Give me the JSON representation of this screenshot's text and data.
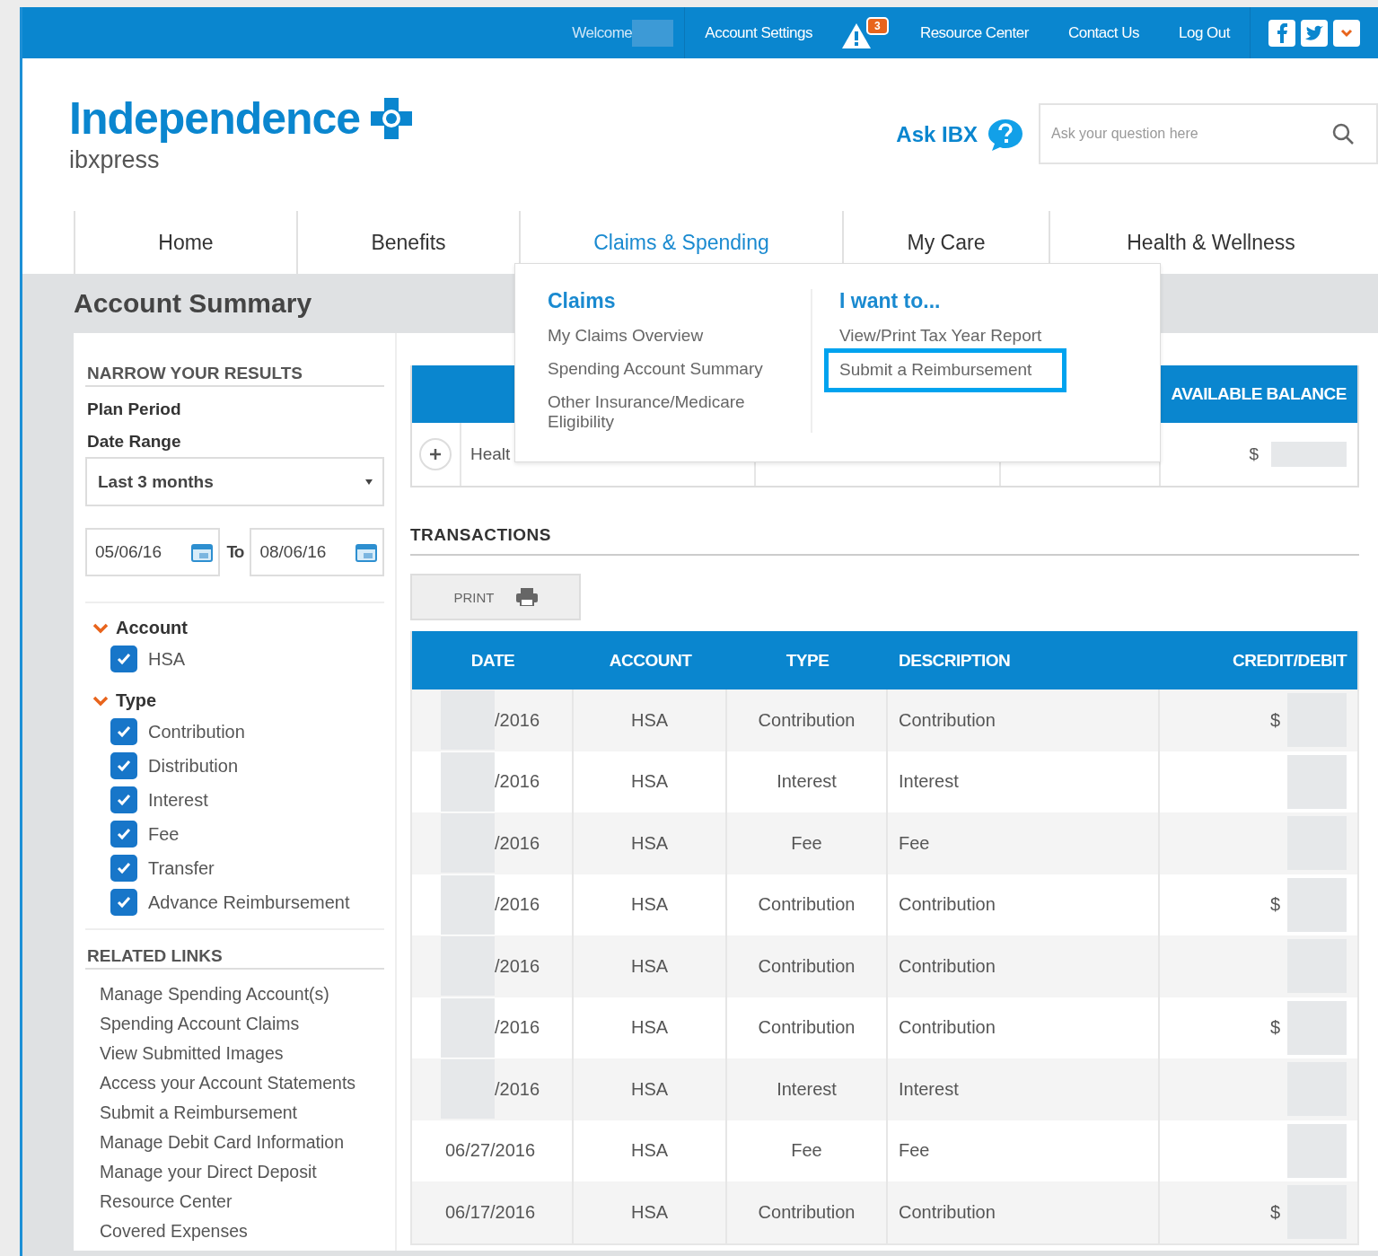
{
  "top_bar": {
    "welcome": "Welcome",
    "links": [
      "Account Settings",
      "Resource Center",
      "Contact Us",
      "Log Out"
    ],
    "alert_count": "3"
  },
  "logo": {
    "name": "Independence",
    "sub": "ibxpress"
  },
  "ask": {
    "label": "Ask IBX",
    "placeholder": "Ask your question here"
  },
  "nav": [
    {
      "label": "Home",
      "selected": false
    },
    {
      "label": "Benefits",
      "selected": false
    },
    {
      "label": "Claims & Spending",
      "selected": true
    },
    {
      "label": "My Care",
      "selected": false
    },
    {
      "label": "Health & Wellness",
      "selected": false
    }
  ],
  "dropdown": {
    "sections": [
      {
        "title": "Claims",
        "links": [
          {
            "label": "My Claims Overview",
            "highlighted": false
          },
          {
            "label": "Spending Account Summary",
            "highlighted": false
          },
          {
            "label": "Other Insurance/Medicare Eligibility",
            "highlighted": false
          }
        ]
      },
      {
        "title": "I want to...",
        "links": [
          {
            "label": "View/Print Tax Year Report",
            "highlighted": false
          },
          {
            "label": "Submit a Reimbursement",
            "highlighted": true
          }
        ]
      }
    ]
  },
  "page_title": "Account Summary",
  "filters": {
    "heading": "NARROW YOUR RESULTS",
    "plan_period": "Plan Period",
    "date_range_label": "Date Range",
    "date_range": "Last 3 months",
    "from": "05/06/16",
    "to_label": "To",
    "to": "08/06/16",
    "groups": [
      {
        "title": "Account",
        "expanded": true,
        "options": [
          {
            "label": "HSA",
            "checked": true
          }
        ]
      },
      {
        "title": "Type",
        "expanded": true,
        "options": [
          {
            "label": "Contribution",
            "checked": true
          },
          {
            "label": "Distribution",
            "checked": true
          },
          {
            "label": "Interest",
            "checked": true
          },
          {
            "label": "Fee",
            "checked": true
          },
          {
            "label": "Transfer",
            "checked": true
          },
          {
            "label": "Advance Reimbursement",
            "checked": true
          }
        ]
      }
    ]
  },
  "related_links": {
    "heading": "RELATED LINKS",
    "links": [
      "Manage Spending Account(s)",
      "Spending Account Claims",
      "View Submitted Images",
      "Access your Account Statements",
      "Submit a Reimbursement",
      "Manage Debit Card Information",
      "Manage your Direct Deposit",
      "Resource Center",
      "Covered Expenses"
    ]
  },
  "account_table": {
    "balance_header": "AVAILABLE BALANCE",
    "rows": [
      {
        "name": "Healt",
        "balance": "$"
      }
    ]
  },
  "transactions": {
    "title": "TRANSACTIONS",
    "print_label": "PRINT",
    "columns": [
      "DATE",
      "ACCOUNT",
      "TYPE",
      "DESCRIPTION",
      "CREDIT/DEBIT"
    ],
    "rows": [
      {
        "date": "/2016",
        "date_redacted": true,
        "account": "HSA",
        "type": "Contribution",
        "description": "Contribution",
        "credit": "$"
      },
      {
        "date": "/2016",
        "date_redacted": true,
        "account": "HSA",
        "type": "Interest",
        "description": "Interest",
        "credit": ""
      },
      {
        "date": "/2016",
        "date_redacted": true,
        "account": "HSA",
        "type": "Fee",
        "description": "Fee",
        "credit": ""
      },
      {
        "date": "/2016",
        "date_redacted": true,
        "account": "HSA",
        "type": "Contribution",
        "description": "Contribution",
        "credit": "$"
      },
      {
        "date": "/2016",
        "date_redacted": true,
        "account": "HSA",
        "type": "Contribution",
        "description": "Contribution",
        "credit": ""
      },
      {
        "date": "/2016",
        "date_redacted": true,
        "account": "HSA",
        "type": "Contribution",
        "description": "Contribution",
        "credit": "$"
      },
      {
        "date": "/2016",
        "date_redacted": true,
        "account": "HSA",
        "type": "Interest",
        "description": "Interest",
        "credit": ""
      },
      {
        "date": "06/27/2016",
        "date_redacted": false,
        "account": "HSA",
        "type": "Fee",
        "description": "Fee",
        "credit": ""
      },
      {
        "date": "06/17/2016",
        "date_redacted": false,
        "account": "HSA",
        "type": "Contribution",
        "description": "Contribution",
        "credit": "$"
      }
    ]
  }
}
